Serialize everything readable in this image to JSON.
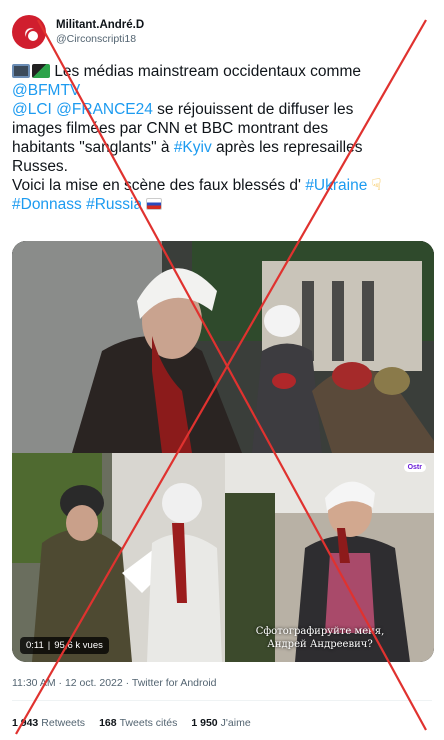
{
  "author": {
    "display_name": "Militant.André.D",
    "handle": "@Circonscripti18"
  },
  "tweet": {
    "line1": "Les médias mainstream occidentaux comme",
    "line2_mention": "@BFMTV",
    "line3_mention1": "@LCI",
    "line3_mention2": "@FRANCE24",
    "line3_text": " se réjouissent de diffuser les",
    "line4": "images filmées par CNN et BBC montrant des",
    "line5_text": "habitants \"sanglants\" à ",
    "line5_hashtag": "#Kyiv",
    "line5_text2": " après les represailles",
    "line6": "Russes.",
    "line7_text": "Voici la mise en scène des faux blessés d' ",
    "line7_hashtag": "#Ukraine",
    "line8_hashtag1": "#Donnass",
    "line8_hashtag2": "#Russia"
  },
  "icons": {
    "tv": "television-icon",
    "clapper": "clapperboard-icon",
    "hand": "pointing-down-hand-icon",
    "flag": "russia-flag-icon"
  },
  "media": {
    "time": "0:11",
    "views": "95,6 k vues",
    "subtitle_line1": "Сфотографируйте меня,",
    "subtitle_line2": "Андрей Андреевич?",
    "watermark": "Ostr"
  },
  "meta": {
    "time": "11:30 AM",
    "separator": "·",
    "date": "12 oct. 2022",
    "source": "Twitter for Android"
  },
  "stats": {
    "retweets_count": "1 943",
    "retweets_label": "Retweets",
    "quotes_count": "168",
    "quotes_label": "Tweets cités",
    "likes_count": "1 950",
    "likes_label": "J'aime"
  },
  "colors": {
    "link": "#1d9bf0",
    "cross": "#e0322f"
  }
}
